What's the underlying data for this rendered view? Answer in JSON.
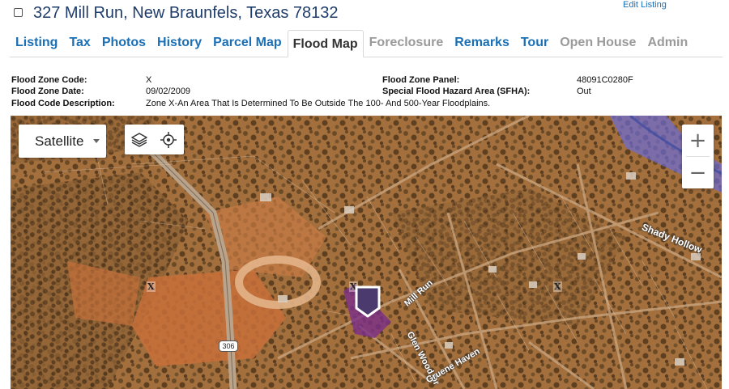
{
  "header": {
    "address": "327 Mill Run, New Braunfels, Texas 78132",
    "edit_link": "Edit Listing"
  },
  "tabs": [
    {
      "label": "Listing",
      "state": "link"
    },
    {
      "label": "Tax",
      "state": "link"
    },
    {
      "label": "Photos",
      "state": "link"
    },
    {
      "label": "History",
      "state": "link"
    },
    {
      "label": "Parcel Map",
      "state": "link"
    },
    {
      "label": "Flood Map",
      "state": "active"
    },
    {
      "label": "Foreclosure",
      "state": "disabled"
    },
    {
      "label": "Remarks",
      "state": "link"
    },
    {
      "label": "Tour",
      "state": "link"
    },
    {
      "label": "Open House",
      "state": "disabled"
    },
    {
      "label": "Admin",
      "state": "disabled"
    }
  ],
  "flood_info": {
    "zone_code_label": "Flood Zone Code:",
    "zone_code": "X",
    "zone_date_label": "Flood Zone Date:",
    "zone_date": "09/02/2009",
    "description_label": "Flood Code Description:",
    "description": "Zone X-An Area That Is Determined To Be Outside The 100- And 500-Year Floodplains.",
    "panel_label": "Flood Zone Panel:",
    "panel": "48091C0280F",
    "sfha_label": "Special Flood Hazard Area (SFHA):",
    "sfha": "Out"
  },
  "map": {
    "map_type": "Satellite",
    "layers_icon": "layers-icon",
    "locate_icon": "crosshair-icon",
    "zoom_in": "+",
    "zoom_out": "−",
    "zone_marker": "X",
    "route_shield": "306",
    "road_labels": {
      "shady_hollow": "Shady Hollow",
      "mill_run": "Mill Run",
      "glenwood": "Glen Wood Dr",
      "gruene_haven": "Gruene Haven"
    },
    "colors": {
      "flood_zone": "#6b6bd6",
      "parcel": "#7a2e8a",
      "marker": "#4b3a6e",
      "link": "#1a6fb5"
    }
  }
}
